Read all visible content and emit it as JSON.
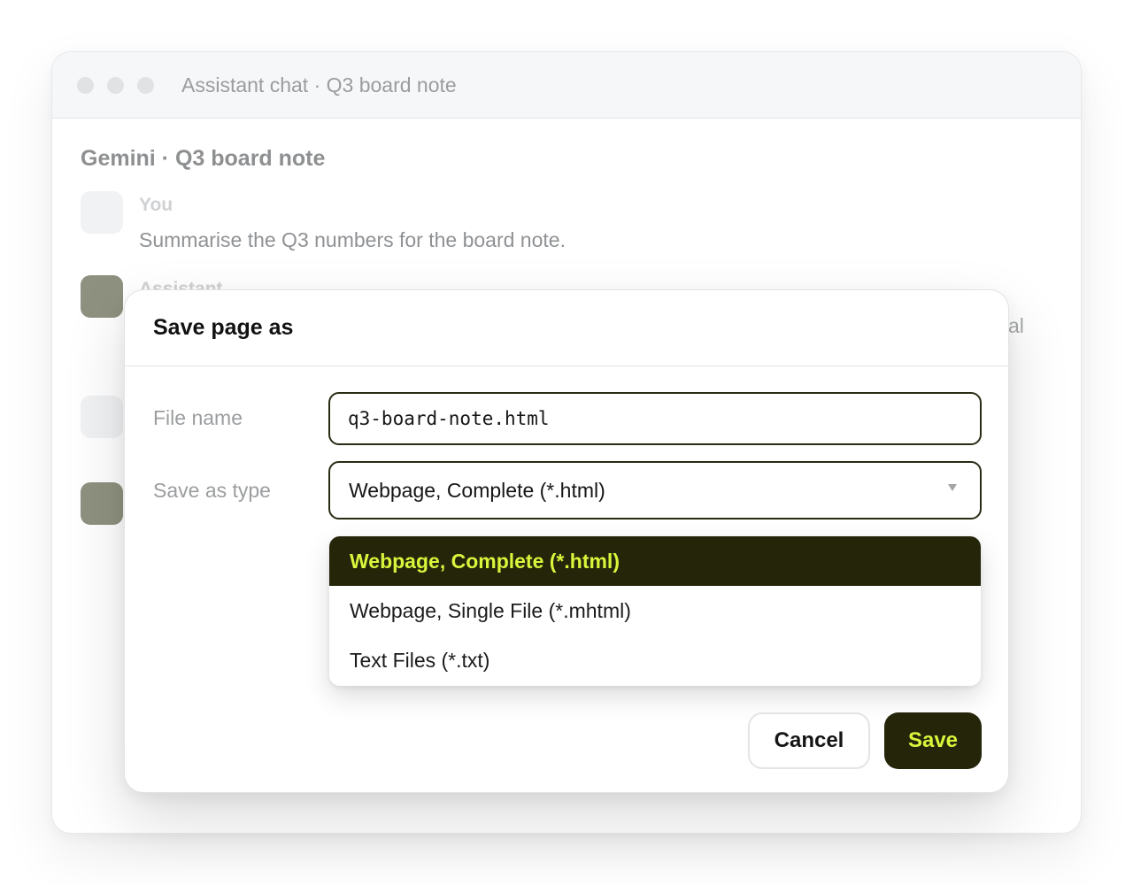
{
  "window": {
    "title": "Assistant chat · Q3 board note"
  },
  "chat": {
    "heading": "Gemini · Q3 board note",
    "messages": [
      {
        "author": "You",
        "text": "Summarise the Q3 numbers for the board note."
      },
      {
        "author": "Assistant",
        "tail": "al"
      }
    ]
  },
  "dialog": {
    "title": "Save page as",
    "file_name_label": "File name",
    "file_name_value": "q3-board-note.html",
    "type_label": "Save as type",
    "type_selected": "Webpage, Complete (*.html)",
    "type_options": [
      "Webpage, Complete (*.html)",
      "Webpage, Single File (*.mhtml)",
      "Text Files (*.txt)"
    ],
    "cancel_label": "Cancel",
    "save_label": "Save"
  },
  "colors": {
    "accent_dark": "#242509",
    "accent_lime": "#d9f53c"
  }
}
